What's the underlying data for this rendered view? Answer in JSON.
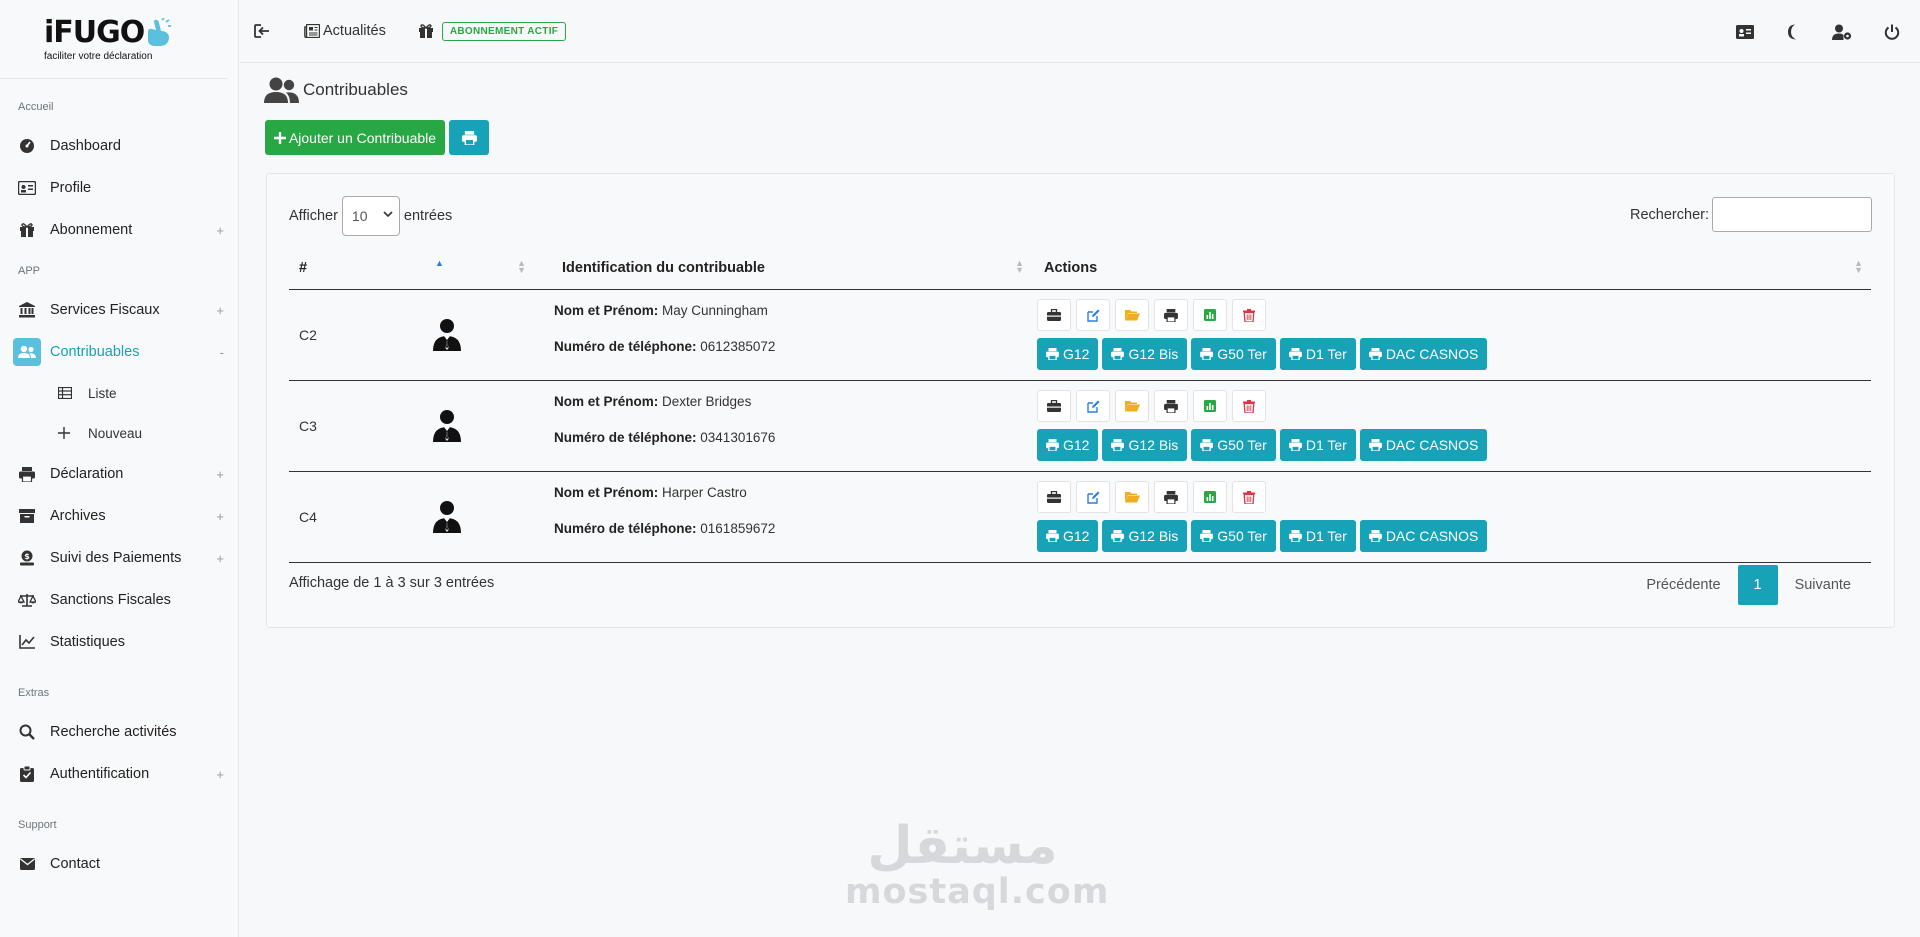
{
  "brand": {
    "logo_text": "iFUGO",
    "tagline": "faciliter votre déclaration"
  },
  "sidebar": {
    "sections": [
      {
        "label": "Accueil"
      },
      {
        "label": "APP"
      },
      {
        "label": "Extras"
      },
      {
        "label": "Support"
      }
    ],
    "items": {
      "dashboard": "Dashboard",
      "profile": "Profile",
      "abonnement": "Abonnement",
      "services": "Services Fiscaux",
      "contribuables": "Contribuables",
      "liste": "Liste",
      "nouveau": "Nouveau",
      "declaration": "Déclaration",
      "archives": "Archives",
      "paiements": "Suivi des Paiements",
      "sanctions": "Sanctions Fiscales",
      "statistiques": "Statistiques",
      "recherche": "Recherche activités",
      "auth": "Authentification",
      "contact": "Contact"
    },
    "expand_plus": "+",
    "collapse_minus": "-"
  },
  "topbar": {
    "news": "Actualités",
    "subscription_badge": "ABONNEMENT ACTIF"
  },
  "page": {
    "title": "Contribuables",
    "add_button": "Ajouter un Contribuable"
  },
  "table": {
    "length_label_before": "Afficher",
    "length_value": "10",
    "length_label_after": "entrées",
    "search_label": "Rechercher:",
    "search_value": "",
    "headers": [
      "#",
      "",
      "Identification du contribuable",
      "Actions"
    ],
    "name_label": "Nom et Prénom:",
    "phone_label": "Numéro de téléphone:",
    "rows": [
      {
        "id": "C2",
        "name": "May Cunningham",
        "phone": "0612385072"
      },
      {
        "id": "C3",
        "name": "Dexter Bridges",
        "phone": "0341301676"
      },
      {
        "id": "C4",
        "name": "Harper Castro",
        "phone": "0161859672"
      }
    ],
    "form_buttons": [
      "G12",
      "G12 Bis",
      "G50 Ter",
      "D1 Ter",
      "DAC CASNOS"
    ],
    "info": "Affichage de 1 à 3 sur 3 entrées",
    "pagination": {
      "prev": "Précédente",
      "current": "1",
      "next": "Suivante"
    }
  },
  "watermark": {
    "arabic": "مستقل",
    "latin": "mostaql.com"
  },
  "colors": {
    "primary": "#17a2b8",
    "success": "#28a745",
    "warning": "#f0ad1e",
    "danger": "#dc3545",
    "edit": "#2a7de1",
    "green_icon": "#28a745"
  }
}
